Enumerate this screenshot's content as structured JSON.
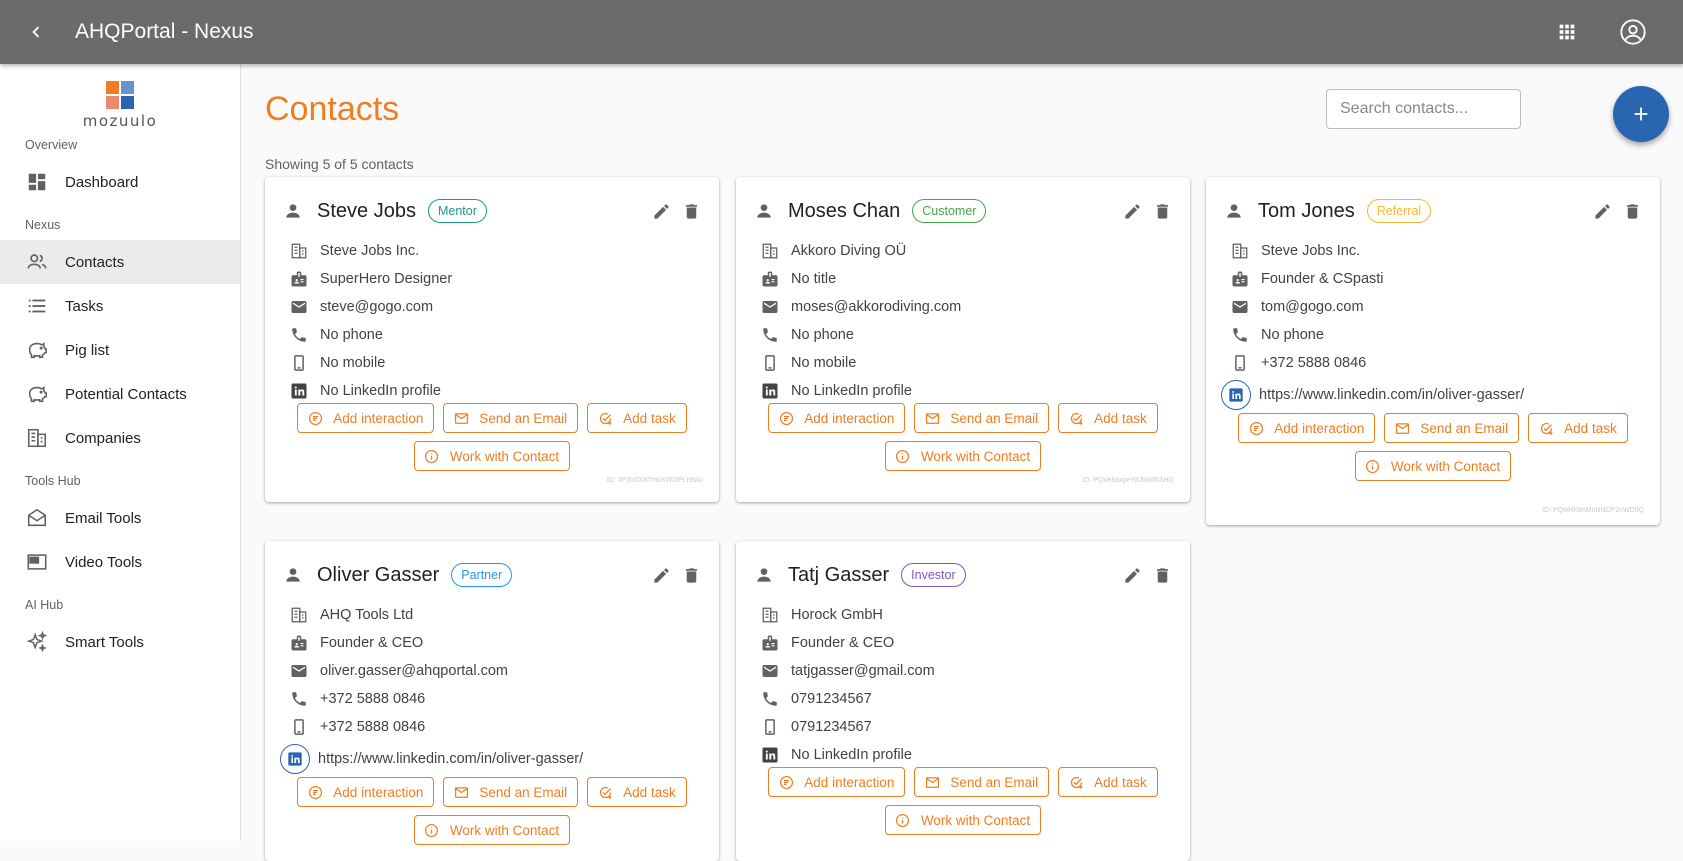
{
  "app": {
    "title": "AHQPortal - Nexus"
  },
  "logo": {
    "word": "mozuulo"
  },
  "sidebar": {
    "sections": [
      {
        "label": "Overview",
        "items": [
          {
            "label": "Dashboard"
          }
        ]
      },
      {
        "label": "Nexus",
        "items": [
          {
            "label": "Contacts"
          },
          {
            "label": "Tasks"
          },
          {
            "label": "Pig list"
          },
          {
            "label": "Potential Contacts"
          },
          {
            "label": "Companies"
          }
        ]
      },
      {
        "label": "Tools Hub",
        "items": [
          {
            "label": "Email Tools"
          },
          {
            "label": "Video Tools"
          }
        ]
      },
      {
        "label": "AI Hub",
        "items": [
          {
            "label": "Smart Tools"
          }
        ]
      }
    ]
  },
  "main": {
    "title": "Contacts",
    "search_placeholder": "Search contacts...",
    "showing": "Showing 5 of 5 contacts"
  },
  "buttons": {
    "add_interaction": "Add interaction",
    "send_email": "Send an Email",
    "add_task": "Add task",
    "work_with": "Work with Contact"
  },
  "colors": {
    "accent": "#ef7d22",
    "primary": "#2a65b2",
    "topbar": "#6b6b6b"
  },
  "contacts": [
    {
      "name": "Steve Jobs",
      "tag": "Mentor",
      "tag_color": "#1a9a8a",
      "company": "Steve Jobs Inc.",
      "title": "SuperHero Designer",
      "email": "steve@gogo.com",
      "phone": "No phone",
      "mobile": "No mobile",
      "linkedin": "No LinkedIn profile",
      "has_linkedin": false,
      "id": "ID: JP3N0X87mbXWI3PLr9Wc"
    },
    {
      "name": "Moses Chan",
      "tag": "Customer",
      "tag_color": "#3fa94a",
      "company": "Akkoro Diving OÜ",
      "title": "No title",
      "email": "moses@akkorodiving.com",
      "phone": "No phone",
      "mobile": "No mobile",
      "linkedin": "No LinkedIn profile",
      "has_linkedin": false,
      "id": "ID: PQVe8axpeYjtJlxWRSHG"
    },
    {
      "name": "Tom Jones",
      "tag": "Referral",
      "tag_color": "#f5b82e",
      "company": "Steve Jobs Inc.",
      "title": "Founder & CSpasti",
      "email": "tom@gogo.com",
      "phone": "No phone",
      "mobile": "+372 5888 0846",
      "linkedin": "https://www.linkedin.com/in/oliver-gasser/",
      "has_linkedin": true,
      "id": "ID: PQwHX8nMnNNCP2nWD9Q"
    },
    {
      "name": "Oliver Gasser",
      "tag": "Partner",
      "tag_color": "#2196f3",
      "company": "AHQ Tools Ltd",
      "title": "Founder & CEO",
      "email": "oliver.gasser@ahqportal.com",
      "phone": "+372 5888 0846",
      "mobile": "+372 5888 0846",
      "linkedin": "https://www.linkedin.com/in/oliver-gasser/",
      "has_linkedin": true,
      "id": ""
    },
    {
      "name": "Tatj Gasser",
      "tag": "Investor",
      "tag_color": "#7e57c2",
      "company": "Horock GmbH",
      "title": "Founder & CEO",
      "email": "tatjgasser@gmail.com",
      "phone": "0791234567",
      "mobile": "0791234567",
      "linkedin": "No LinkedIn profile",
      "has_linkedin": false,
      "id": ""
    }
  ]
}
